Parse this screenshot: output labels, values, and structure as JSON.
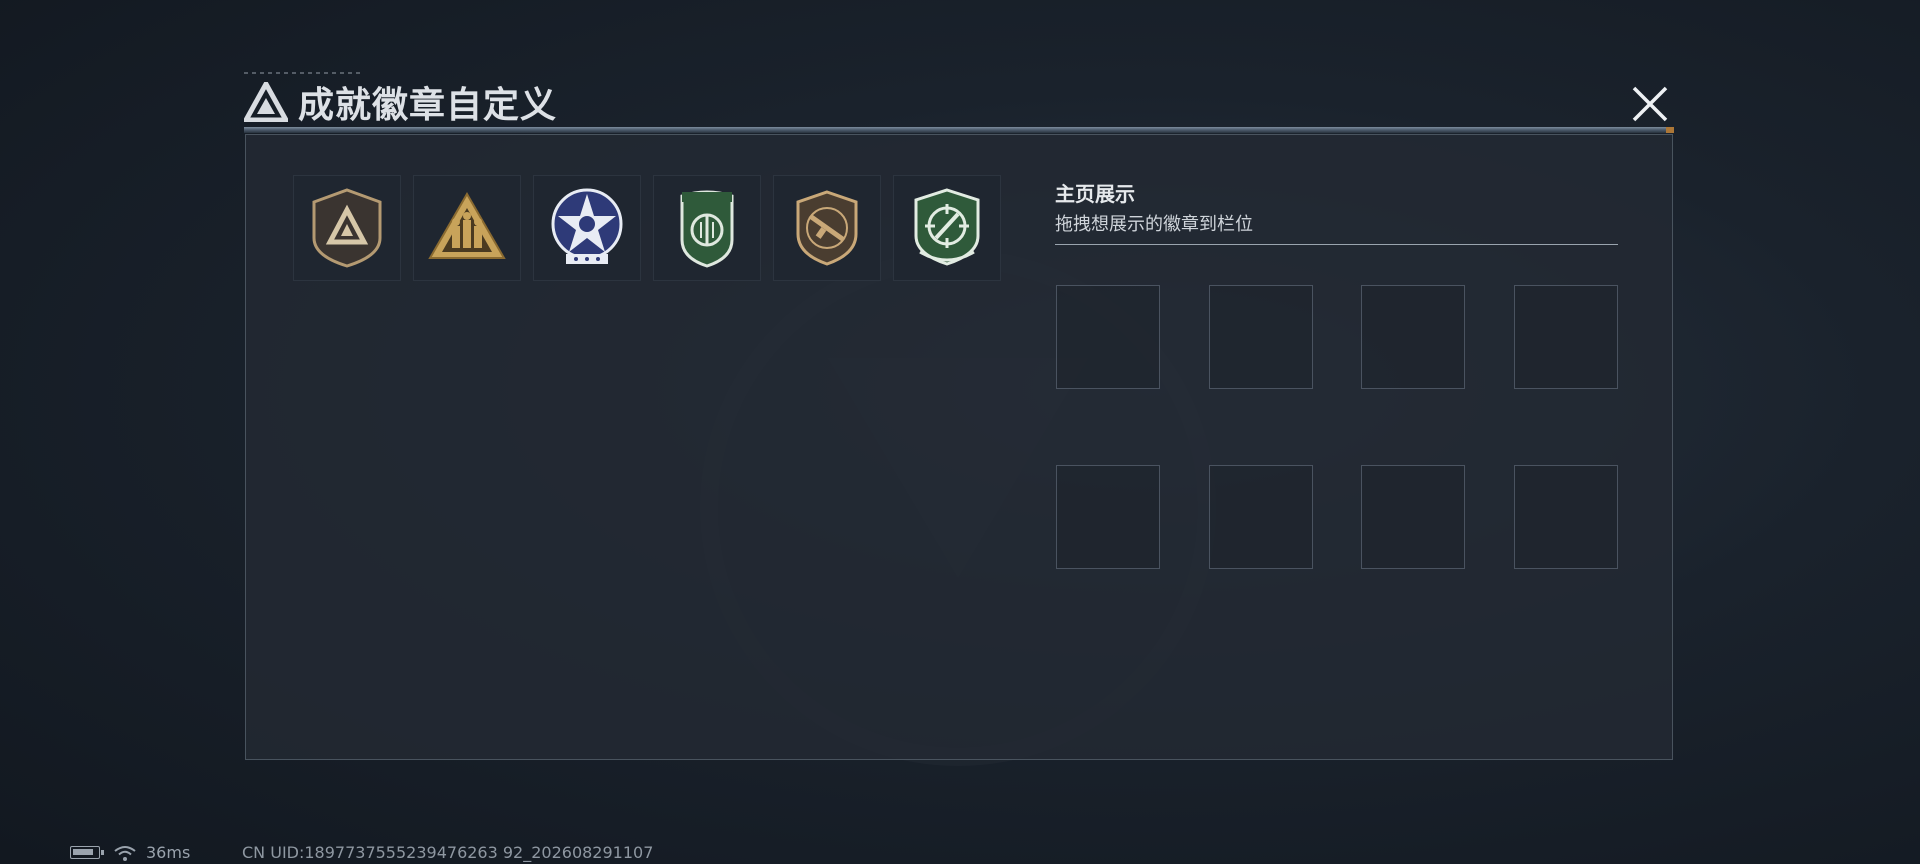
{
  "header": {
    "title": "成就徽章自定义",
    "logo_icon": "delta-triangle-logo-icon",
    "close_icon": "close-icon"
  },
  "badge_list": {
    "items": [
      {
        "name": "delta-shield-badge-icon",
        "colors": [
          "#3a3430",
          "#b49a72"
        ]
      },
      {
        "name": "squad-triangle-badge-icon",
        "colors": [
          "#c8a35a",
          "#4a3a20"
        ]
      },
      {
        "name": "star-emblem-badge-icon",
        "colors": [
          "#2e3a78",
          "#e8ecf4"
        ]
      },
      {
        "name": "green-shield-badge-icon",
        "colors": [
          "#2f5a3a",
          "#dfe8df"
        ]
      },
      {
        "name": "rifle-shield-badge-icon",
        "colors": [
          "#4a3d30",
          "#c9a878"
        ]
      },
      {
        "name": "crosshair-shield-badge-icon",
        "colors": [
          "#2f5a3a",
          "#e2ece2"
        ]
      }
    ]
  },
  "showcase": {
    "title": "主页展示",
    "subtitle": "拖拽想展示的徽章到栏位",
    "slots_count": 8
  },
  "status_bar": {
    "ping": "36ms",
    "uid": "CN UID:1897737555239476263 92_202608291107"
  }
}
